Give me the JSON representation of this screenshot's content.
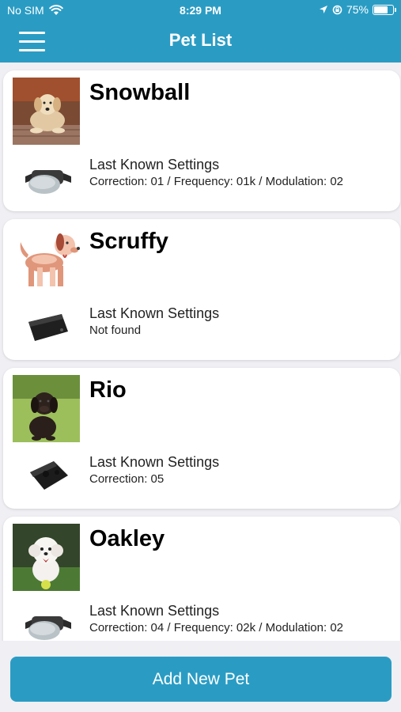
{
  "status_bar": {
    "carrier": "No SIM",
    "time": "8:29 PM",
    "battery": "75%",
    "battery_level": 0.75
  },
  "header": {
    "title": "Pet List",
    "menu_icon": "hamburger-menu-icon"
  },
  "pets": [
    {
      "name": "Snowball",
      "photo": "golden-retriever-photo",
      "collar_icon": "gray-collar-icon",
      "settings_title": "Last Known Settings",
      "settings_value": "Correction: 01 / Frequency: 01k / Modulation: 02"
    },
    {
      "name": "Scruffy",
      "photo": "cartoon-dog-illustration",
      "collar_icon": "black-receiver-icon",
      "settings_title": "Last Known Settings",
      "settings_value": "Not found"
    },
    {
      "name": "Rio",
      "photo": "black-puppy-photo",
      "collar_icon": "black-receiver-icon",
      "settings_title": "Last Known Settings",
      "settings_value": "Correction: 05"
    },
    {
      "name": "Oakley",
      "photo": "white-puppy-photo",
      "collar_icon": "gray-collar-icon",
      "settings_title": "Last Known Settings",
      "settings_value": "Correction: 04 / Frequency: 02k / Modulation: 02"
    }
  ],
  "footer": {
    "add_button_label": "Add New Pet"
  },
  "colors": {
    "accent": "#2a9cc4",
    "background": "#efeff4",
    "card": "#ffffff"
  }
}
